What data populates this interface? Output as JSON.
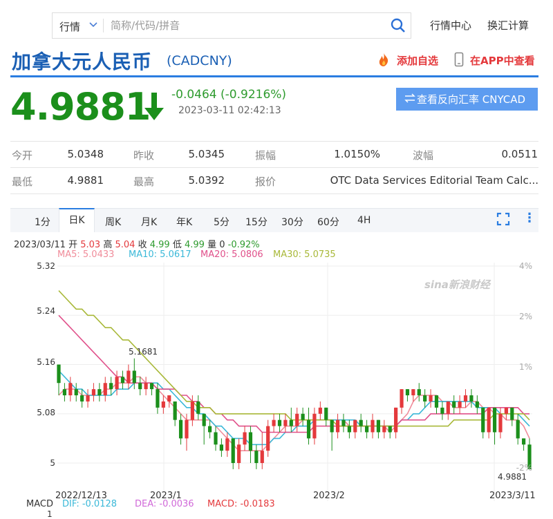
{
  "search": {
    "type_label": "行情",
    "placeholder": "简称/代码/拼音"
  },
  "top_links": [
    "行情中心",
    "换汇计算"
  ],
  "title": "加拿大元人民币",
  "code": "(CADCNY)",
  "actions": {
    "add_watch": "添加自选",
    "view_app": "在APP中查看"
  },
  "colors": {
    "brand_blue": "#1a5fb4",
    "down_green": "#1b8f1b",
    "up_red": "#e4393c",
    "button_blue": "#5d9cf0"
  },
  "quote": {
    "price": "4.9881",
    "direction_icon": "down-arrow-icon",
    "change": "-0.0464 (-0.9216%)",
    "time": "2023-03-11 02:42:13",
    "reverse_button": "查看反向汇率 CNYCAD"
  },
  "stats": [
    [
      {
        "label": "今开",
        "value": "5.0348"
      },
      {
        "label": "昨收",
        "value": "5.0345"
      },
      {
        "label": "振幅",
        "value": "1.0150%"
      },
      {
        "label": "波幅",
        "value": "0.0511"
      }
    ],
    [
      {
        "label": "最低",
        "value": "4.9881"
      },
      {
        "label": "最高",
        "value": "5.0392"
      },
      {
        "label": "报价",
        "value": "OTC Data Services Editorial Team Calc..."
      }
    ]
  ],
  "tabs": [
    "1分",
    "日K",
    "周K",
    "月K",
    "年K",
    "5分",
    "15分",
    "30分",
    "60分",
    "4H"
  ],
  "active_tab": "日K",
  "info_bar": {
    "date": "2023/03/11",
    "open_label": "开",
    "open": "5.03",
    "high_label": "高",
    "high": "5.04",
    "close_label": "收",
    "close": "4.99",
    "low_label": "低",
    "low": "4.99",
    "vol_label": "量",
    "vol": "0",
    "pct": "-0.92%"
  },
  "ma_values": [
    {
      "label": "MA5: 5.0433",
      "color": "#f08c9a"
    },
    {
      "label": "MA10: 5.0617",
      "color": "#3ab8d8"
    },
    {
      "label": "MA20: 5.0806",
      "color": "#e0508a"
    },
    {
      "label": "MA30: 5.0735",
      "color": "#a8b838"
    }
  ],
  "watermark": "sina新浪财经",
  "annotations": {
    "high_marker": "5.1681",
    "last_price_marker": "4.9881"
  },
  "macd": {
    "label": "MACD",
    "dif": "DIF: -0.0128",
    "dea": "DEA: -0.0036",
    "macd": "MACD: -0.0183",
    "axis_top": "1"
  },
  "chart_data": {
    "type": "candlestick",
    "title": "",
    "y_ticks": [
      "5.32",
      "5.24",
      "5.16",
      "5.08",
      "5"
    ],
    "y_right_ticks": [
      "4%",
      "2%",
      "1%",
      "-2%"
    ],
    "x_ticks": [
      "2022/12/13",
      "2023/1",
      "2023/2",
      "2023/3/11"
    ],
    "ylim": [
      4.97,
      5.33
    ],
    "candles": [
      [
        5.16,
        5.13,
        5.11,
        5.16
      ],
      [
        5.12,
        5.11,
        5.1,
        5.13
      ],
      [
        5.11,
        5.13,
        5.1,
        5.14
      ],
      [
        5.12,
        5.11,
        5.1,
        5.13
      ],
      [
        5.11,
        5.1,
        5.09,
        5.12
      ],
      [
        5.1,
        5.11,
        5.09,
        5.12
      ],
      [
        5.11,
        5.12,
        5.1,
        5.13
      ],
      [
        5.12,
        5.11,
        5.1,
        5.13
      ],
      [
        5.11,
        5.13,
        5.1,
        5.14
      ],
      [
        5.13,
        5.12,
        5.11,
        5.14
      ],
      [
        5.12,
        5.14,
        5.11,
        5.15
      ],
      [
        5.14,
        5.13,
        5.12,
        5.15
      ],
      [
        5.13,
        5.15,
        5.12,
        5.16
      ],
      [
        5.15,
        5.13,
        5.12,
        5.17
      ],
      [
        5.13,
        5.12,
        5.11,
        5.14
      ],
      [
        5.12,
        5.13,
        5.11,
        5.14
      ],
      [
        5.13,
        5.12,
        5.11,
        5.13
      ],
      [
        5.12,
        5.09,
        5.08,
        5.13
      ],
      [
        5.09,
        5.1,
        5.08,
        5.11
      ],
      [
        5.1,
        5.11,
        5.09,
        5.11
      ],
      [
        5.1,
        5.07,
        5.06,
        5.1
      ],
      [
        5.07,
        5.04,
        5.03,
        5.08
      ],
      [
        5.04,
        5.07,
        5.02,
        5.08
      ],
      [
        5.07,
        5.1,
        5.06,
        5.11
      ],
      [
        5.1,
        5.08,
        5.07,
        5.11
      ],
      [
        5.08,
        5.06,
        5.03,
        5.08
      ],
      [
        5.06,
        5.05,
        5.04,
        5.07
      ],
      [
        5.05,
        5.03,
        5.02,
        5.06
      ],
      [
        5.03,
        5.02,
        5.01,
        5.04
      ],
      [
        5.02,
        5.04,
        5.01,
        5.05
      ],
      [
        5.04,
        5.0,
        4.99,
        5.04
      ],
      [
        5.0,
        5.03,
        4.99,
        5.04
      ],
      [
        5.03,
        5.05,
        5.02,
        5.06
      ],
      [
        5.05,
        5.02,
        5.0,
        5.06
      ],
      [
        5.02,
        5.0,
        4.99,
        5.03
      ],
      [
        5.0,
        5.02,
        4.99,
        5.05
      ],
      [
        5.02,
        5.06,
        5.01,
        5.07
      ],
      [
        5.06,
        5.07,
        5.05,
        5.08
      ],
      [
        5.07,
        5.06,
        5.05,
        5.08
      ],
      [
        5.06,
        5.07,
        5.05,
        5.08
      ],
      [
        5.07,
        5.06,
        5.05,
        5.09
      ],
      [
        5.06,
        5.08,
        5.05,
        5.09
      ],
      [
        5.08,
        5.07,
        5.06,
        5.09
      ],
      [
        5.07,
        5.04,
        5.03,
        5.09
      ],
      [
        5.04,
        5.08,
        5.03,
        5.09
      ],
      [
        5.08,
        5.09,
        5.07,
        5.1
      ],
      [
        5.09,
        5.07,
        5.06,
        5.09
      ],
      [
        5.07,
        5.05,
        5.02,
        5.07
      ],
      [
        5.05,
        5.07,
        5.04,
        5.08
      ],
      [
        5.07,
        5.06,
        5.05,
        5.08
      ],
      [
        5.06,
        5.05,
        5.04,
        5.07
      ],
      [
        5.05,
        5.07,
        5.04,
        5.07
      ],
      [
        5.07,
        5.06,
        5.05,
        5.08
      ],
      [
        5.06,
        5.05,
        5.04,
        5.07
      ],
      [
        5.05,
        5.07,
        5.04,
        5.08
      ],
      [
        5.07,
        5.05,
        5.04,
        5.07
      ],
      [
        5.05,
        5.06,
        5.04,
        5.07
      ],
      [
        5.06,
        5.05,
        5.04,
        5.06
      ],
      [
        5.05,
        5.09,
        5.04,
        5.09
      ],
      [
        5.09,
        5.12,
        5.08,
        5.12
      ],
      [
        5.12,
        5.11,
        5.1,
        5.12
      ],
      [
        5.11,
        5.12,
        5.1,
        5.12
      ],
      [
        5.12,
        5.11,
        5.1,
        5.13
      ],
      [
        5.11,
        5.1,
        5.09,
        5.12
      ],
      [
        5.1,
        5.11,
        5.09,
        5.12
      ],
      [
        5.11,
        5.09,
        5.08,
        5.11
      ],
      [
        5.09,
        5.08,
        5.07,
        5.1
      ],
      [
        5.08,
        5.1,
        5.07,
        5.1
      ],
      [
        5.1,
        5.09,
        5.08,
        5.11
      ],
      [
        5.09,
        5.1,
        5.08,
        5.11
      ],
      [
        5.1,
        5.11,
        5.09,
        5.12
      ],
      [
        5.11,
        5.1,
        5.09,
        5.12
      ],
      [
        5.1,
        5.09,
        5.08,
        5.11
      ],
      [
        5.09,
        5.05,
        5.04,
        5.09
      ],
      [
        5.05,
        5.09,
        5.04,
        5.09
      ],
      [
        5.09,
        5.05,
        5.03,
        5.09
      ],
      [
        5.05,
        5.08,
        5.04,
        5.09
      ],
      [
        5.08,
        5.09,
        5.07,
        5.09
      ],
      [
        5.09,
        5.07,
        5.06,
        5.09
      ],
      [
        5.07,
        5.04,
        5.03,
        5.08
      ],
      [
        5.04,
        5.03,
        5.02,
        5.04
      ],
      [
        5.03,
        4.99,
        4.99,
        5.04
      ]
    ],
    "ma_series": [
      {
        "name": "MA5",
        "color": "#f08c9a",
        "values": [
          5.11,
          5.12,
          5.12,
          5.12,
          5.11,
          5.11,
          5.11,
          5.11,
          5.12,
          5.12,
          5.13,
          5.13,
          5.13,
          5.14,
          5.14,
          5.13,
          5.13,
          5.12,
          5.11,
          5.1,
          5.09,
          5.08,
          5.07,
          5.07,
          5.07,
          5.07,
          5.07,
          5.06,
          5.05,
          5.04,
          5.03,
          5.02,
          5.02,
          5.02,
          5.02,
          5.02,
          5.03,
          5.04,
          5.05,
          5.06,
          5.06,
          5.06,
          5.07,
          5.07,
          5.07,
          5.07,
          5.07,
          5.07,
          5.07,
          5.07,
          5.06,
          5.06,
          5.06,
          5.06,
          5.06,
          5.06,
          5.06,
          5.05,
          5.06,
          5.07,
          5.08,
          5.1,
          5.11,
          5.11,
          5.11,
          5.11,
          5.1,
          5.1,
          5.09,
          5.09,
          5.09,
          5.1,
          5.1,
          5.09,
          5.09,
          5.08,
          5.08,
          5.07,
          5.07,
          5.07,
          5.06,
          5.04
        ]
      },
      {
        "name": "MA10",
        "color": "#3ab8d8",
        "values": [
          5.15,
          5.14,
          5.13,
          5.12,
          5.12,
          5.11,
          5.11,
          5.11,
          5.11,
          5.11,
          5.12,
          5.12,
          5.12,
          5.13,
          5.13,
          5.13,
          5.13,
          5.13,
          5.12,
          5.12,
          5.11,
          5.1,
          5.09,
          5.09,
          5.08,
          5.08,
          5.07,
          5.06,
          5.06,
          5.05,
          5.04,
          5.04,
          5.04,
          5.03,
          5.03,
          5.03,
          5.03,
          5.04,
          5.04,
          5.05,
          5.05,
          5.06,
          5.06,
          5.06,
          5.07,
          5.07,
          5.07,
          5.07,
          5.07,
          5.07,
          5.07,
          5.07,
          5.06,
          5.06,
          5.06,
          5.06,
          5.06,
          5.06,
          5.06,
          5.07,
          5.07,
          5.08,
          5.08,
          5.09,
          5.1,
          5.1,
          5.1,
          5.1,
          5.1,
          5.1,
          5.1,
          5.1,
          5.09,
          5.09,
          5.09,
          5.09,
          5.08,
          5.08,
          5.08,
          5.08,
          5.07,
          5.06
        ]
      },
      {
        "name": "MA20",
        "color": "#e0508a",
        "values": [
          5.24,
          5.23,
          5.22,
          5.21,
          5.2,
          5.19,
          5.18,
          5.17,
          5.16,
          5.15,
          5.14,
          5.14,
          5.13,
          5.13,
          5.13,
          5.13,
          5.13,
          5.12,
          5.12,
          5.12,
          5.12,
          5.11,
          5.11,
          5.1,
          5.1,
          5.09,
          5.09,
          5.08,
          5.08,
          5.07,
          5.07,
          5.06,
          5.06,
          5.06,
          5.06,
          5.05,
          5.05,
          5.05,
          5.05,
          5.05,
          5.05,
          5.05,
          5.05,
          5.05,
          5.06,
          5.06,
          5.06,
          5.06,
          5.06,
          5.06,
          5.06,
          5.06,
          5.06,
          5.06,
          5.06,
          5.06,
          5.06,
          5.06,
          5.06,
          5.07,
          5.07,
          5.07,
          5.07,
          5.07,
          5.08,
          5.08,
          5.08,
          5.08,
          5.08,
          5.08,
          5.08,
          5.08,
          5.08,
          5.08,
          5.09,
          5.09,
          5.09,
          5.09,
          5.09,
          5.09,
          5.08,
          5.08
        ]
      },
      {
        "name": "MA30",
        "color": "#a8b838",
        "values": [
          5.28,
          5.27,
          5.26,
          5.25,
          5.25,
          5.24,
          5.24,
          5.23,
          5.22,
          5.22,
          5.21,
          5.2,
          5.2,
          5.19,
          5.18,
          5.17,
          5.16,
          5.15,
          5.14,
          5.13,
          5.12,
          5.11,
          5.1,
          5.1,
          5.09,
          5.09,
          5.09,
          5.08,
          5.08,
          5.08,
          5.08,
          5.08,
          5.08,
          5.08,
          5.08,
          5.08,
          5.08,
          5.08,
          5.08,
          5.08,
          5.07,
          5.07,
          5.07,
          5.07,
          5.07,
          5.07,
          5.07,
          5.07,
          5.06,
          5.06,
          5.06,
          5.06,
          5.06,
          5.06,
          5.06,
          5.06,
          5.06,
          5.06,
          5.06,
          5.06,
          5.06,
          5.06,
          5.06,
          5.06,
          5.06,
          5.06,
          5.06,
          5.06,
          5.07,
          5.07,
          5.07,
          5.07,
          5.07,
          5.07,
          5.07,
          5.08,
          5.08,
          5.08,
          5.08,
          5.08,
          5.08,
          5.07
        ]
      }
    ]
  }
}
